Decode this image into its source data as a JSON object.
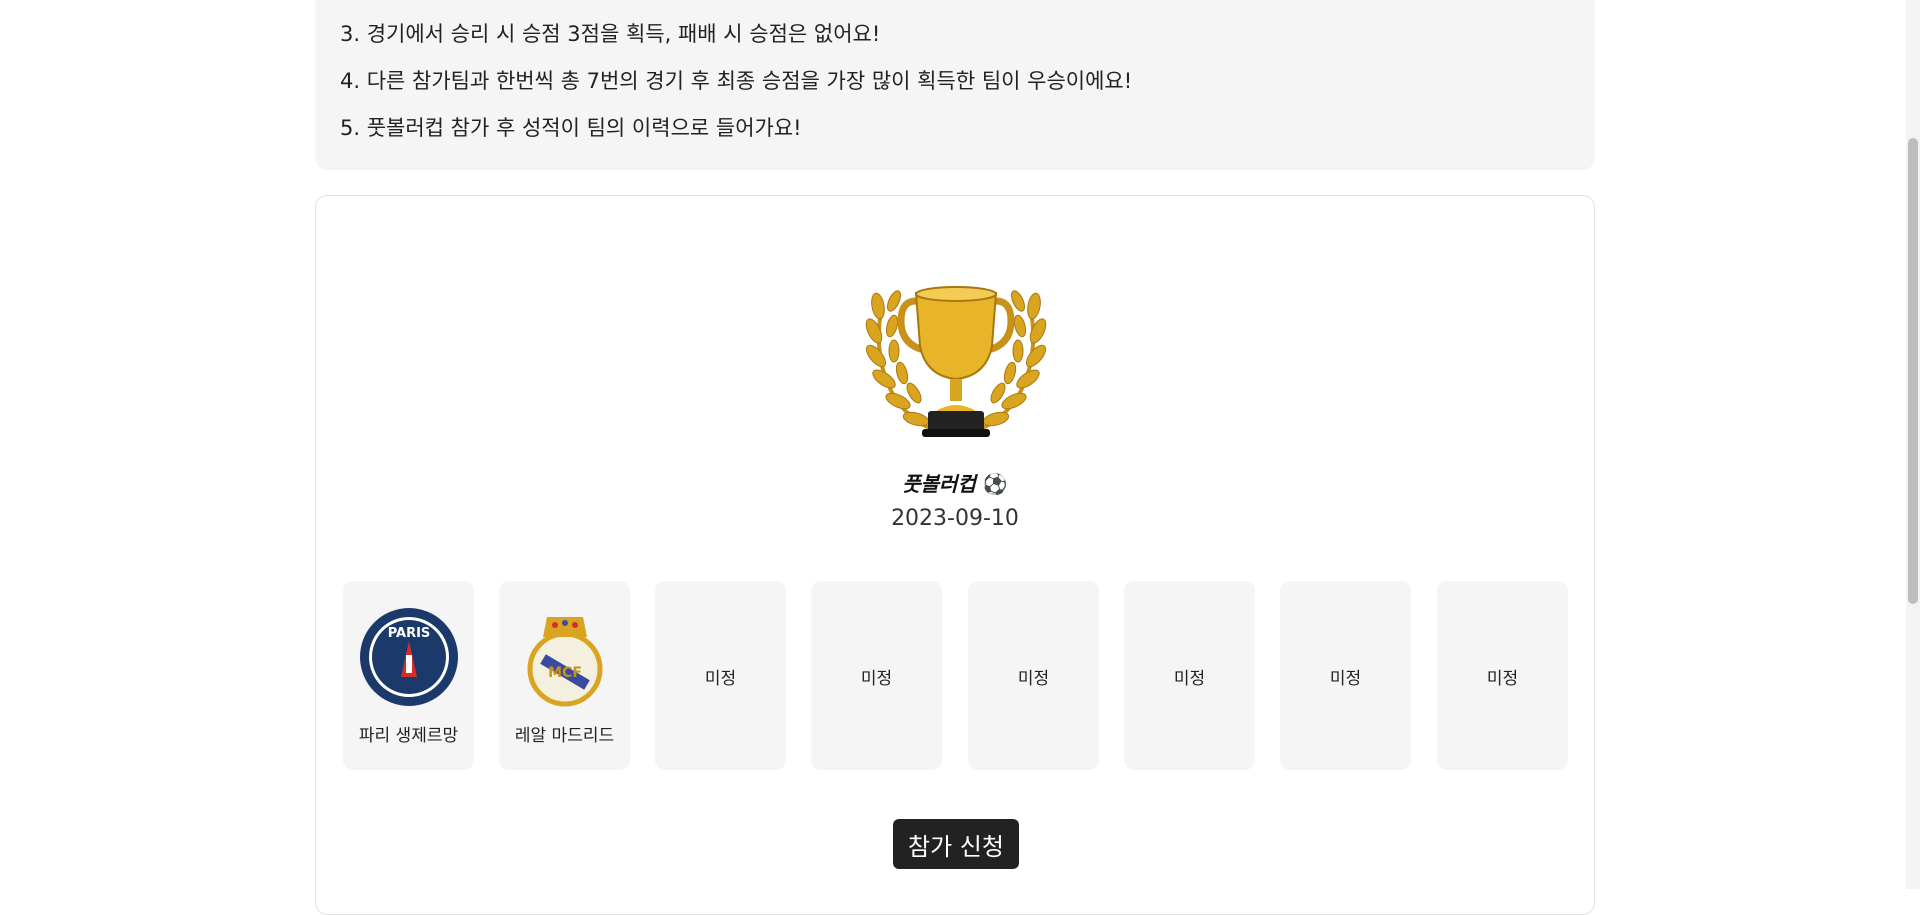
{
  "rules": [
    "3. 경기에서 승리 시 승점 3점을 획득, 패배 시 승점은 없어요!",
    "4. 다른 참가팀과 한번씩 총 7번의 경기 후 최종 승점을 가장 많이 획득한 팀이 우승이에요!",
    "5. 풋볼러컵 참가 후 성적이 팀의 이력으로 들어가요!"
  ],
  "cup": {
    "title": "풋볼러컵",
    "date": "2023-09-10",
    "trophy_icon": "trophy-icon"
  },
  "teams": [
    {
      "name": "파리 생제르망",
      "icon": "psg-logo-icon",
      "logo_text": "PARIS"
    },
    {
      "name": "레알 마드리드",
      "icon": "real-madrid-logo-icon",
      "logo_text": "MCF"
    },
    {
      "name": "미정"
    },
    {
      "name": "미정"
    },
    {
      "name": "미정"
    },
    {
      "name": "미정"
    },
    {
      "name": "미정"
    },
    {
      "name": "미정"
    }
  ],
  "join_button": "참가 신청",
  "colors": {
    "panel_bg": "#f5f5f5",
    "button_bg": "#222222",
    "accent_gold": "#d9a520",
    "psg_blue": "#1b3a6b",
    "psg_red": "#d62c2c"
  }
}
